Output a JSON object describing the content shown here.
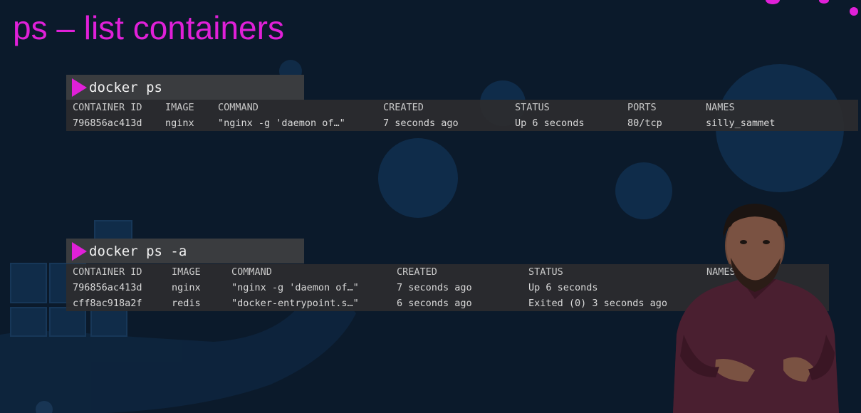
{
  "slide": {
    "title": "ps – list containers"
  },
  "colors": {
    "accent": "#e020d8",
    "background": "#0b1a2b",
    "terminal_bg": "#2c2c2e",
    "command_bar_bg": "#3a3c3f"
  },
  "block1": {
    "command": "docker ps",
    "headers": [
      "CONTAINER ID",
      "IMAGE",
      "COMMAND",
      "CREATED",
      "STATUS",
      "PORTS",
      "NAMES"
    ],
    "rows": [
      [
        "796856ac413d",
        "nginx",
        "\"nginx -g 'daemon of…\"",
        "7 seconds ago",
        "Up 6 seconds",
        "80/tcp",
        "silly_sammet"
      ]
    ]
  },
  "block2": {
    "command": "docker ps -a",
    "headers": [
      "CONTAINER ID",
      "IMAGE",
      "COMMAND",
      "CREATED",
      "STATUS",
      "NAMES"
    ],
    "rows": [
      [
        "796856ac413d",
        "nginx",
        "\"nginx -g 'daemon of…\"",
        "7 seconds ago",
        "Up 6 seconds",
        ""
      ],
      [
        "cff8ac918a2f",
        "redis",
        "\"docker-entrypoint.s…\"",
        "6 seconds ago",
        "Exited (0) 3 seconds ago",
        ""
      ]
    ]
  }
}
